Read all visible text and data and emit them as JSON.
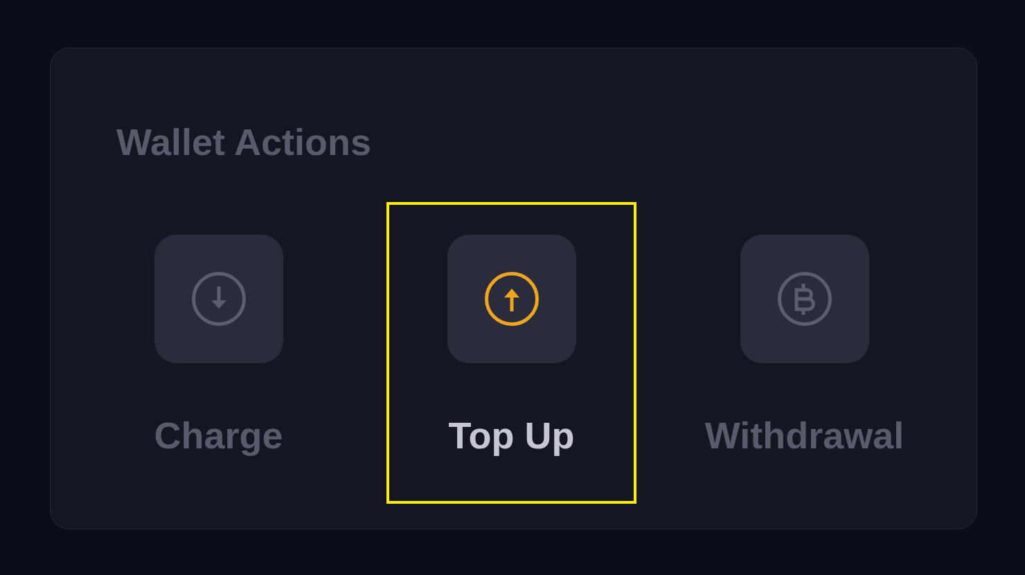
{
  "card": {
    "title": "Wallet Actions"
  },
  "actions": [
    {
      "kind": "charge",
      "label": "Charge",
      "selected": false
    },
    {
      "kind": "topup",
      "label": "Top Up",
      "selected": true
    },
    {
      "kind": "withdrawal",
      "label": "Withdrawal",
      "selected": false
    }
  ]
}
